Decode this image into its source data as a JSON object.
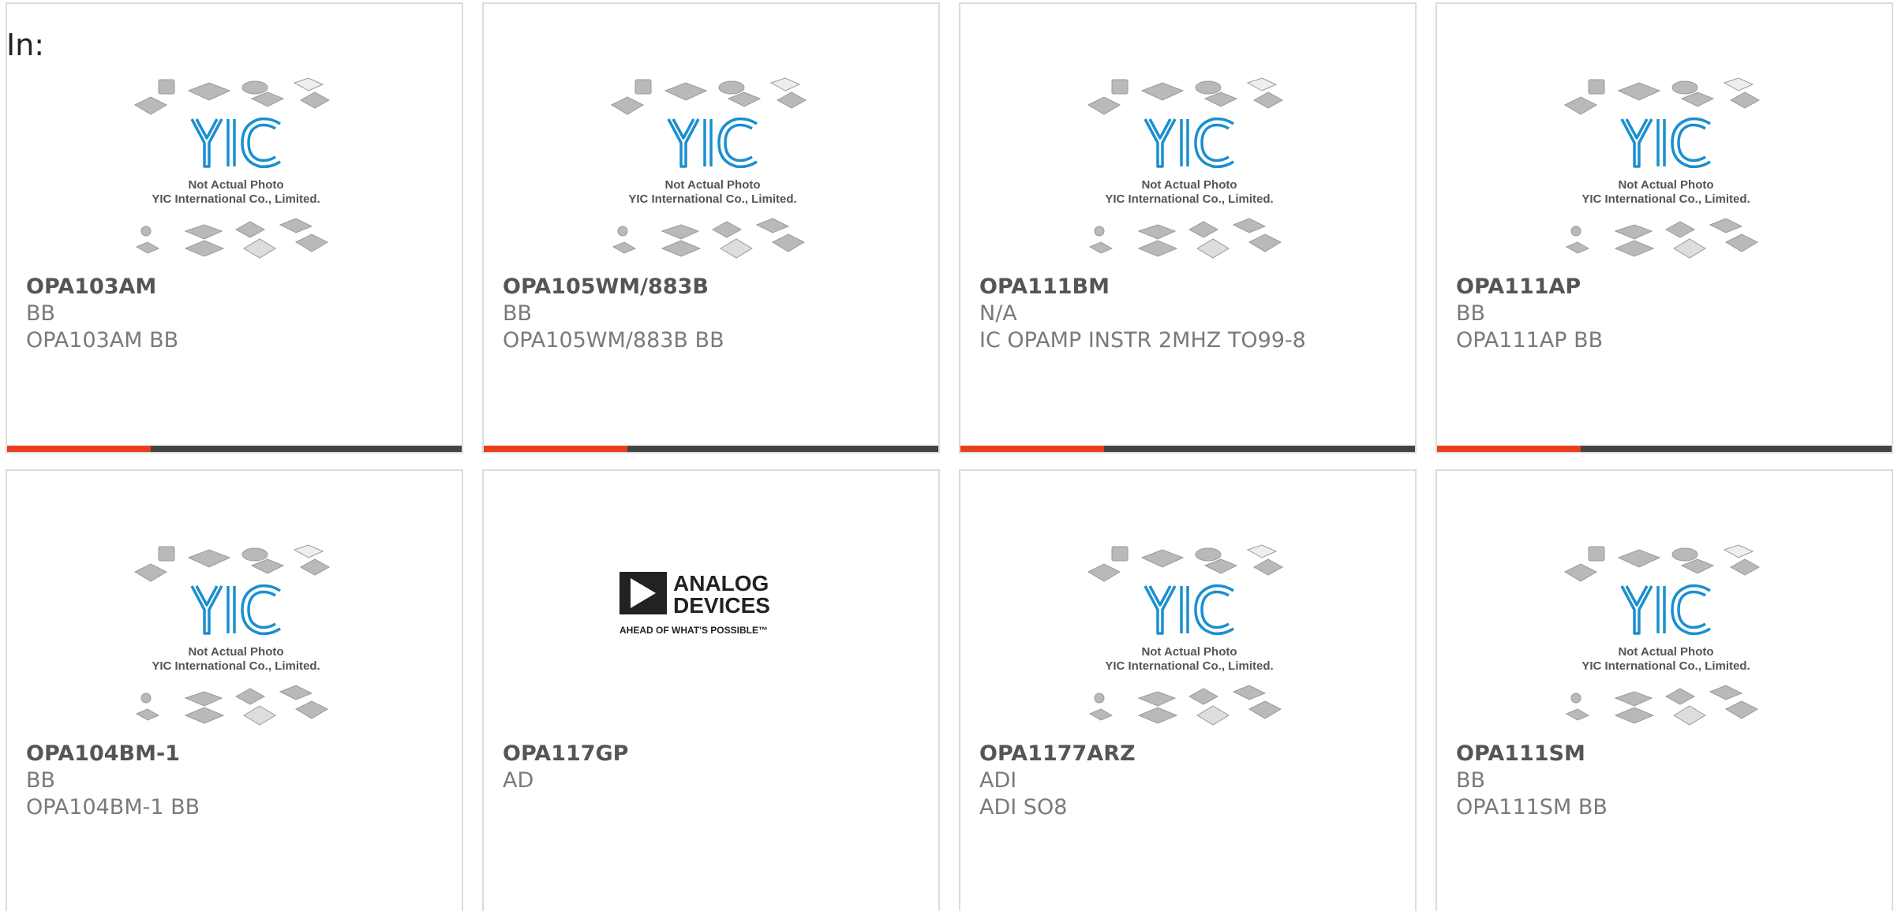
{
  "header": {
    "label": "In:"
  },
  "placeholder_image": {
    "line1": "Not Actual Photo",
    "line2": "YIC International Co., Limited.",
    "logo_text": "YIC"
  },
  "adi_logo": {
    "line1": "ANALOG",
    "line2": "DEVICES",
    "tagline": "AHEAD OF WHAT'S POSSIBLE™"
  },
  "colors": {
    "accent": "#e8401c",
    "bar": "#444444",
    "yic_blue": "#1a8fd0"
  },
  "products": [
    {
      "part": "OPA103AM",
      "mfr": "BB",
      "desc": "OPA103AM BB",
      "image": "yic-placeholder"
    },
    {
      "part": "OPA105WM/883B",
      "mfr": "BB",
      "desc": "OPA105WM/883B BB",
      "image": "yic-placeholder"
    },
    {
      "part": "OPA111BM",
      "mfr": "N/A",
      "desc": "IC OPAMP INSTR 2MHZ TO99-8",
      "image": "yic-placeholder"
    },
    {
      "part": "OPA111AP",
      "mfr": "BB",
      "desc": "OPA111AP BB",
      "image": "yic-placeholder"
    },
    {
      "part": "OPA104BM-1",
      "mfr": "BB",
      "desc": "OPA104BM-1 BB",
      "image": "yic-placeholder"
    },
    {
      "part": "OPA117GP",
      "mfr": "AD",
      "desc": "",
      "image": "analog-devices-logo"
    },
    {
      "part": "OPA1177ARZ",
      "mfr": "ADI",
      "desc": "ADI SO8",
      "image": "yic-placeholder"
    },
    {
      "part": "OPA111SM",
      "mfr": "BB",
      "desc": "OPA111SM BB",
      "image": "yic-placeholder"
    }
  ]
}
